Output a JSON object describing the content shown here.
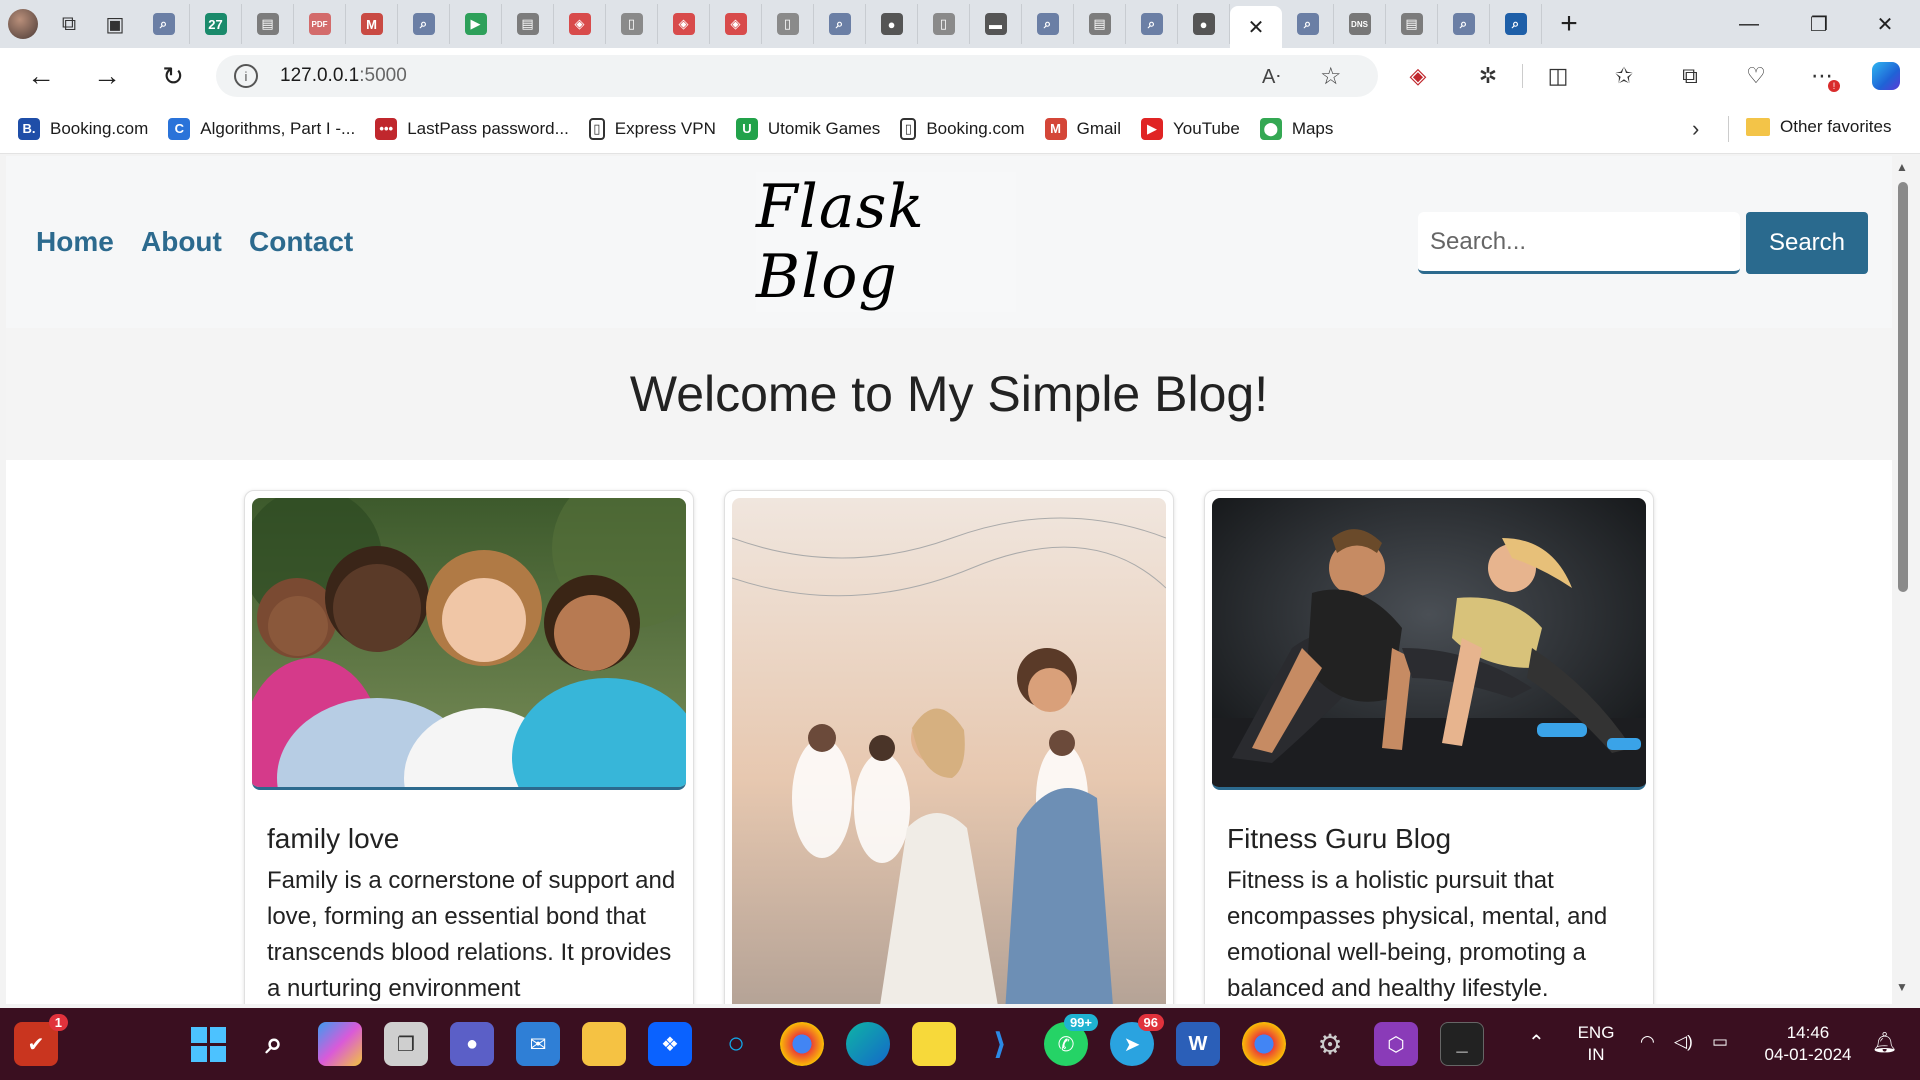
{
  "browser": {
    "url_host": "127.0.0.1",
    "url_port": ":5000",
    "tabs": [
      {
        "icon": "search-icon",
        "glyph": "⌕",
        "color": "#6b7fa5"
      },
      {
        "icon": "calendar-27-icon",
        "glyph": "27",
        "color": "#1a8a6b"
      },
      {
        "icon": "page-icon",
        "glyph": "▤",
        "color": "#7c7c7c"
      },
      {
        "icon": "pdf-icon",
        "glyph": "PDF",
        "color": "#d36b6b"
      },
      {
        "icon": "gmail-icon",
        "glyph": "M",
        "color": "#c94a43"
      },
      {
        "icon": "search-icon",
        "glyph": "⌕",
        "color": "#6b7fa5"
      },
      {
        "icon": "meet-icon",
        "glyph": "▶",
        "color": "#2ea05a"
      },
      {
        "icon": "page-icon",
        "glyph": "▤",
        "color": "#7c7c7c"
      },
      {
        "icon": "shield-icon",
        "glyph": "◈",
        "color": "#d84b4b"
      },
      {
        "icon": "doc-icon",
        "glyph": "▯",
        "color": "#8a8a8a"
      },
      {
        "icon": "shield-icon",
        "glyph": "◈",
        "color": "#d84b4b"
      },
      {
        "icon": "shield-icon",
        "glyph": "◈",
        "color": "#d84b4b"
      },
      {
        "icon": "doc-icon",
        "glyph": "▯",
        "color": "#8a8a8a"
      },
      {
        "icon": "search-icon",
        "glyph": "⌕",
        "color": "#6b7fa5"
      },
      {
        "icon": "github-icon",
        "glyph": "●",
        "color": "#555"
      },
      {
        "icon": "doc-icon",
        "glyph": "▯",
        "color": "#8a8a8a"
      },
      {
        "icon": "video-icon",
        "glyph": "▬",
        "color": "#555"
      },
      {
        "icon": "search-icon",
        "glyph": "⌕",
        "color": "#6b7fa5"
      },
      {
        "icon": "page-icon",
        "glyph": "▤",
        "color": "#7c7c7c"
      },
      {
        "icon": "search-icon",
        "glyph": "⌕",
        "color": "#6b7fa5"
      },
      {
        "icon": "github-icon",
        "glyph": "●",
        "color": "#555"
      }
    ],
    "tabs_after_active": [
      {
        "icon": "search-icon",
        "glyph": "⌕",
        "color": "#6b7fa5"
      },
      {
        "icon": "dns-icon",
        "glyph": "DNS",
        "color": "#777"
      },
      {
        "icon": "page-icon",
        "glyph": "▤",
        "color": "#7c7c7c"
      },
      {
        "icon": "search-icon",
        "glyph": "⌕",
        "color": "#6b7fa5"
      },
      {
        "icon": "search-icon",
        "glyph": "⌕",
        "color": "#1e5fa8"
      }
    ],
    "active_tab_close": "✕",
    "new_tab": "+",
    "bookmarks": [
      {
        "label": "Booking.com",
        "icon": "booking-icon",
        "glyph": "B.",
        "color": "#1f4ea8"
      },
      {
        "label": "Algorithms, Part I -...",
        "icon": "coursera-icon",
        "glyph": "C",
        "color": "#2a73d9"
      },
      {
        "label": "LastPass password...",
        "icon": "lastpass-icon",
        "glyph": "•••",
        "color": "#c0272d"
      },
      {
        "label": "Express VPN",
        "icon": "page-icon",
        "glyph": "▯",
        "color": "#ffffff"
      },
      {
        "label": "Utomik Games",
        "icon": "utomik-icon",
        "glyph": "U",
        "color": "#22a24a"
      },
      {
        "label": "Booking.com",
        "icon": "page-icon",
        "glyph": "▯",
        "color": "#ffffff"
      },
      {
        "label": "Gmail",
        "icon": "gmail-icon",
        "glyph": "M",
        "color": "#d44638"
      },
      {
        "label": "YouTube",
        "icon": "youtube-icon",
        "glyph": "▶",
        "color": "#e02424"
      },
      {
        "label": "Maps",
        "icon": "maps-pin-icon",
        "glyph": "⬤",
        "color": "#34a853"
      }
    ],
    "other_favorites": "Other favorites"
  },
  "site": {
    "nav": [
      "Home",
      "About",
      "Contact"
    ],
    "logo": "Flask Blog",
    "search_placeholder": "Search...",
    "search_button": "Search",
    "welcome": "Welcome to My Simple Blog!",
    "posts": [
      {
        "title": "family love",
        "text": "Family is a cornerstone of support and love, forming an essential bond that transcends blood relations. It provides a nurturing environment"
      },
      {
        "title": "",
        "text": ""
      },
      {
        "title": "Fitness Guru Blog",
        "text": "Fitness is a holistic pursuit that encompasses physical, mental, and emotional well-being, promoting a balanced and healthy lifestyle."
      }
    ]
  },
  "taskbar": {
    "language": "ENG",
    "region": "IN",
    "time": "14:46",
    "date": "04-01-2024",
    "badges": {
      "whatsapp": "99+",
      "telegram": "96",
      "app_alert": "1"
    }
  }
}
